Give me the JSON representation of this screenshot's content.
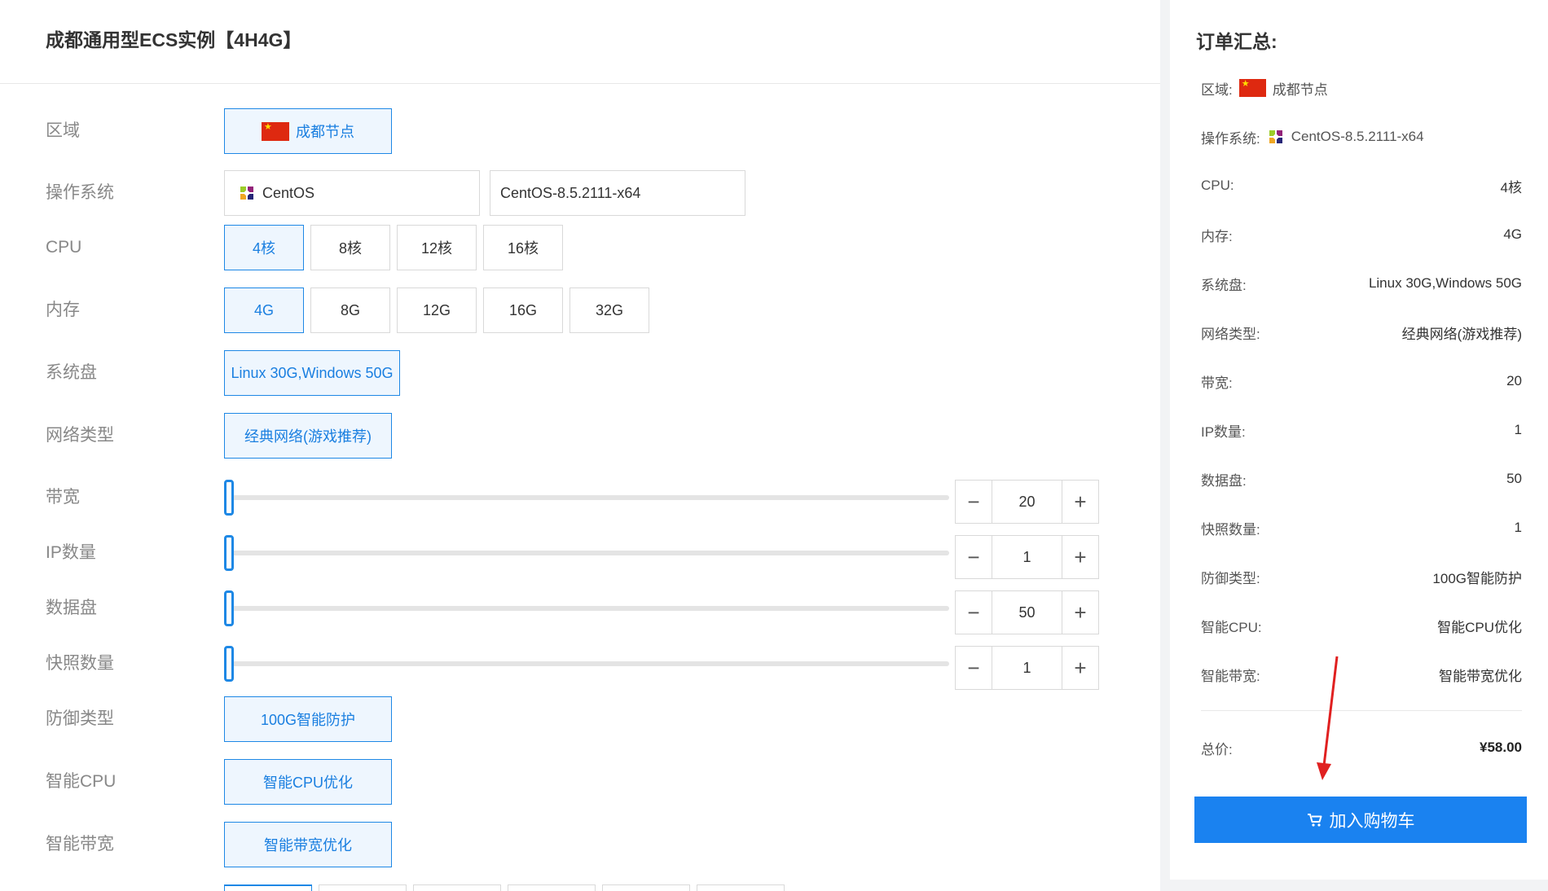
{
  "page": {
    "title": "成都通用型ECS实例【4H4G】"
  },
  "config": {
    "region": {
      "label": "区域",
      "option": "成都节点",
      "flag_icon": "china-flag-icon"
    },
    "os": {
      "label": "操作系统",
      "family": "CentOS",
      "version": "CentOS-8.5.2111-x64",
      "icon": "centos-logo-icon"
    },
    "cpu": {
      "label": "CPU",
      "options": [
        "4核",
        "8核",
        "12核",
        "16核"
      ],
      "selected": "4核"
    },
    "memory": {
      "label": "内存",
      "options": [
        "4G",
        "8G",
        "12G",
        "16G",
        "32G"
      ],
      "selected": "4G"
    },
    "system_disk": {
      "label": "系统盘",
      "option": "Linux 30G,Windows 50G"
    },
    "network": {
      "label": "网络类型",
      "option": "经典网络(游戏推荐)"
    },
    "bandwidth": {
      "label": "带宽",
      "value": "20",
      "slider_fraction": 0
    },
    "ip_count": {
      "label": "IP数量",
      "value": "1",
      "slider_fraction": 0
    },
    "data_disk": {
      "label": "数据盘",
      "value": "50",
      "slider_fraction": 0
    },
    "snapshots": {
      "label": "快照数量",
      "value": "1",
      "slider_fraction": 0
    },
    "defense": {
      "label": "防御类型",
      "option": "100G智能防护"
    },
    "smart_cpu": {
      "label": "智能CPU",
      "option": "智能CPU优化"
    },
    "smart_bandwidth": {
      "label": "智能带宽",
      "option": "智能带宽优化"
    },
    "stepper": {
      "minus": "−",
      "plus": "+"
    }
  },
  "summary": {
    "title": "订单汇总:",
    "region": {
      "label": "区域:",
      "value": "成都节点"
    },
    "os": {
      "label": "操作系统:",
      "value": "CentOS-8.5.2111-x64"
    },
    "rows": [
      {
        "label": "CPU:",
        "value": "4核"
      },
      {
        "label": "内存:",
        "value": "4G"
      },
      {
        "label": "系统盘:",
        "value": "Linux 30G,Windows 50G"
      },
      {
        "label": "网络类型:",
        "value": "经典网络(游戏推荐)"
      },
      {
        "label": "带宽:",
        "value": "20"
      },
      {
        "label": "IP数量:",
        "value": "1"
      },
      {
        "label": "数据盘:",
        "value": "50"
      },
      {
        "label": "快照数量:",
        "value": "1"
      },
      {
        "label": "防御类型:",
        "value": "100G智能防护"
      },
      {
        "label": "智能CPU:",
        "value": "智能CPU优化"
      },
      {
        "label": "智能带宽:",
        "value": "智能带宽优化"
      }
    ],
    "total": {
      "label": "总价:",
      "value": "¥58.00"
    },
    "cart_button": "加入购物车"
  },
  "colors": {
    "accent": "#1a82f0",
    "active_bg": "#eef6fe",
    "annotation_arrow": "#e02020"
  }
}
